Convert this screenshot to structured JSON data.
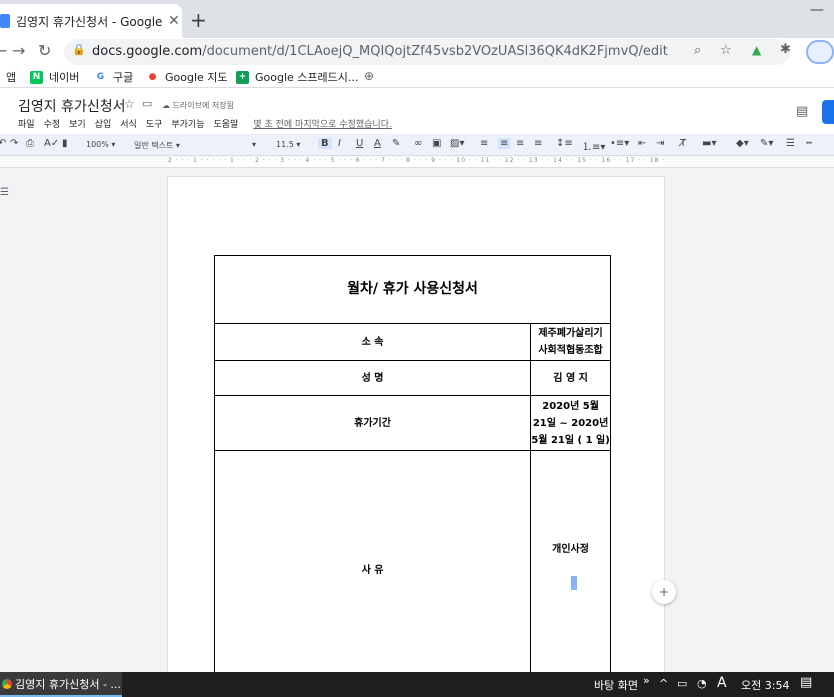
{
  "browser": {
    "tab_title": "김영지 휴가신청서 - Google 문서",
    "url_domain": "docs.google.com",
    "url_path": "/document/d/1CLAoejQ_MQIQojtZf45vsb2VOzUASl36QK4dK2FjmvQ/edit"
  },
  "bookmarks": [
    {
      "label": "앱",
      "icon": "apps-icon"
    },
    {
      "label": "네이버",
      "icon": "naver-icon",
      "color": "#03c75a"
    },
    {
      "label": "구글",
      "icon": "google-icon",
      "color": "#4285f4"
    },
    {
      "label": "Google 지도",
      "icon": "maps-icon",
      "color": "#ea4335"
    },
    {
      "label": "Google 스프레드시...",
      "icon": "sheets-icon",
      "color": "#0f9d58"
    }
  ],
  "docs": {
    "title": "김영지 휴가신청서",
    "saved_status": "드라이브에 저장됨",
    "menu": [
      "파일",
      "수정",
      "보기",
      "삽입",
      "서식",
      "도구",
      "부가기능",
      "도움말"
    ],
    "last_edit": "몇 초 전에 마지막으로 수정했습니다."
  },
  "toolbar": {
    "zoom": "100%",
    "style": "일반 텍스트",
    "font_size": "11.5"
  },
  "ruler": "2 · · · 1 · · · · · 1 · · · 2 · · · 3 · · · 4 · · · 5 · · · 6 · · · 7 · · · 8 · · · 9 · · · 10 · · 11 · · 12 · · 13 · · 14 · · 15 · · 16 · · 17 · · 18 · · 19",
  "form": {
    "title": "월차/ 휴가 사용신청서",
    "rows": [
      {
        "label": "소 속",
        "value_lines": [
          "제주폐가살리기",
          "사회적협동조합"
        ]
      },
      {
        "label": "성 명",
        "value_lines": [
          "김 영 지"
        ]
      },
      {
        "label": "휴가기간",
        "value_lines": [
          "2020년 5월",
          "21일 ~ 2020년",
          "5월 21일 ( 1 일)"
        ]
      },
      {
        "label": "사 유",
        "value_lines": [
          "개인사정"
        ]
      }
    ]
  },
  "taskbar": {
    "app_label": "김영지 휴가신청서 - ...",
    "toolbar_label": "바탕 화면",
    "ime": "A",
    "clock": "오전 3:54"
  }
}
